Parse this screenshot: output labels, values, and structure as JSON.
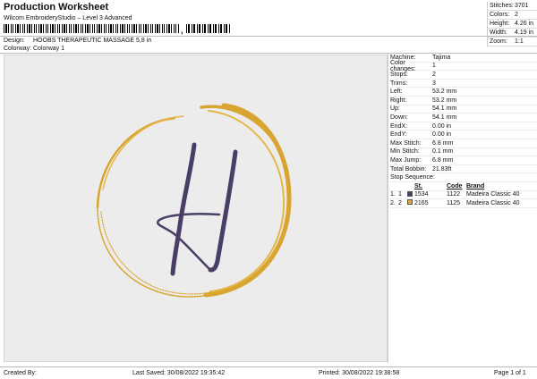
{
  "header": {
    "title": "Production Worksheet",
    "subtitle": "Wilcom EmbroideryStudio – Level 3 Advanced",
    "barcode_suffix": ","
  },
  "top_stats": [
    {
      "label": "Stitches:",
      "value": "3701"
    },
    {
      "label": "Colors:",
      "value": "2"
    },
    {
      "label": "Height:",
      "value": "4.26 in"
    },
    {
      "label": "Width:",
      "value": "4.19 in"
    },
    {
      "label": "Zoom:",
      "value": "1:1"
    }
  ],
  "design": {
    "design_label": "Design:",
    "design_value": "HOOBS THERAPEUTIC MASSAGE 5,8 in",
    "colorway_label": "Colorway:",
    "colorway_value": "Colorway 1"
  },
  "details": [
    {
      "label": "Machine:",
      "value": "Tajima"
    },
    {
      "label": "Color changes:",
      "value": "1"
    },
    {
      "label": "Stops:",
      "value": "2"
    },
    {
      "label": "Trims:",
      "value": "3"
    },
    {
      "label": "Left:",
      "value": "53.2 mm"
    },
    {
      "label": "Right:",
      "value": "53.2 mm"
    },
    {
      "label": "Up:",
      "value": "54.1 mm"
    },
    {
      "label": "Down:",
      "value": "54.1 mm"
    },
    {
      "label": "EndX:",
      "value": "0.00 in"
    },
    {
      "label": "EndY:",
      "value": "0.00 in"
    },
    {
      "label": "Max Stitch:",
      "value": "6.8 mm"
    },
    {
      "label": "Min Stitch:",
      "value": "0.1 mm"
    },
    {
      "label": "Max Jump:",
      "value": "6.8 mm"
    },
    {
      "label": "Total Bobbin:",
      "value": "21.83ft"
    }
  ],
  "stop_sequence": {
    "title": "Stop Sequence:",
    "headers": {
      "st": "St.",
      "code": "Code",
      "brand": "Brand"
    },
    "rows": [
      {
        "idx": "1.",
        "n": "1",
        "color": "#4a3d66",
        "st": "1534",
        "code": "1122",
        "brand": "Madeira Classic 40"
      },
      {
        "idx": "2.",
        "n": "2",
        "color": "#e0a93a",
        "st": "2165",
        "code": "1125",
        "brand": "Madeira Classic 40"
      }
    ]
  },
  "colors": {
    "thread_purple": "#4a3d66",
    "thread_gold": "#d9a531",
    "canvas_bg": "#ececec"
  },
  "footer": {
    "created_by": "Created By:",
    "last_saved": "Last Saved: 30/08/2022 19:35:42",
    "printed": "Printed: 30/08/2022 19:38:58",
    "page": "Page 1 of 1"
  }
}
